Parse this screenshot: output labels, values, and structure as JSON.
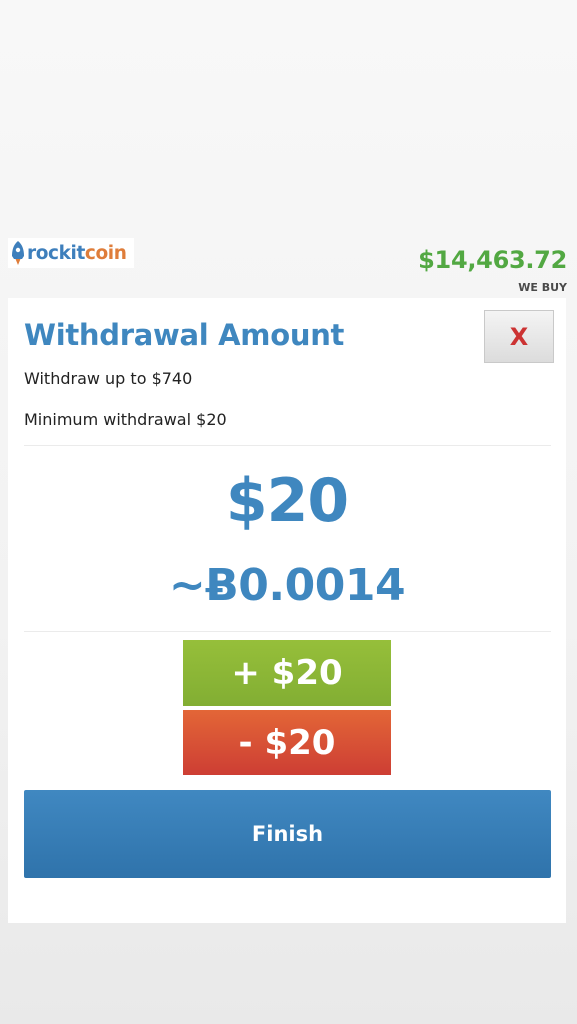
{
  "header": {
    "logo_left": "rockit",
    "logo_right": "coin",
    "price": "$14,463.72",
    "price_label": "WE BUY"
  },
  "dialog": {
    "title": "Withdrawal Amount",
    "close_label": "X",
    "max_text": "Withdraw up to $740",
    "min_text": "Minimum withdrawal $20",
    "amount": "$20",
    "btc_amount": "~Ƀ0.0014",
    "increment_label": "+ $20",
    "decrement_label": "- $20",
    "finish_label": "Finish"
  },
  "colors": {
    "brand_blue": "#3f87bf",
    "brand_orange": "#df7d3a",
    "price_green": "#52a842",
    "increment_green": "#8cb83a",
    "decrement_red": "#d94e35",
    "close_red": "#cc3333"
  },
  "icons": {
    "logo_mark": "rocket-icon"
  }
}
